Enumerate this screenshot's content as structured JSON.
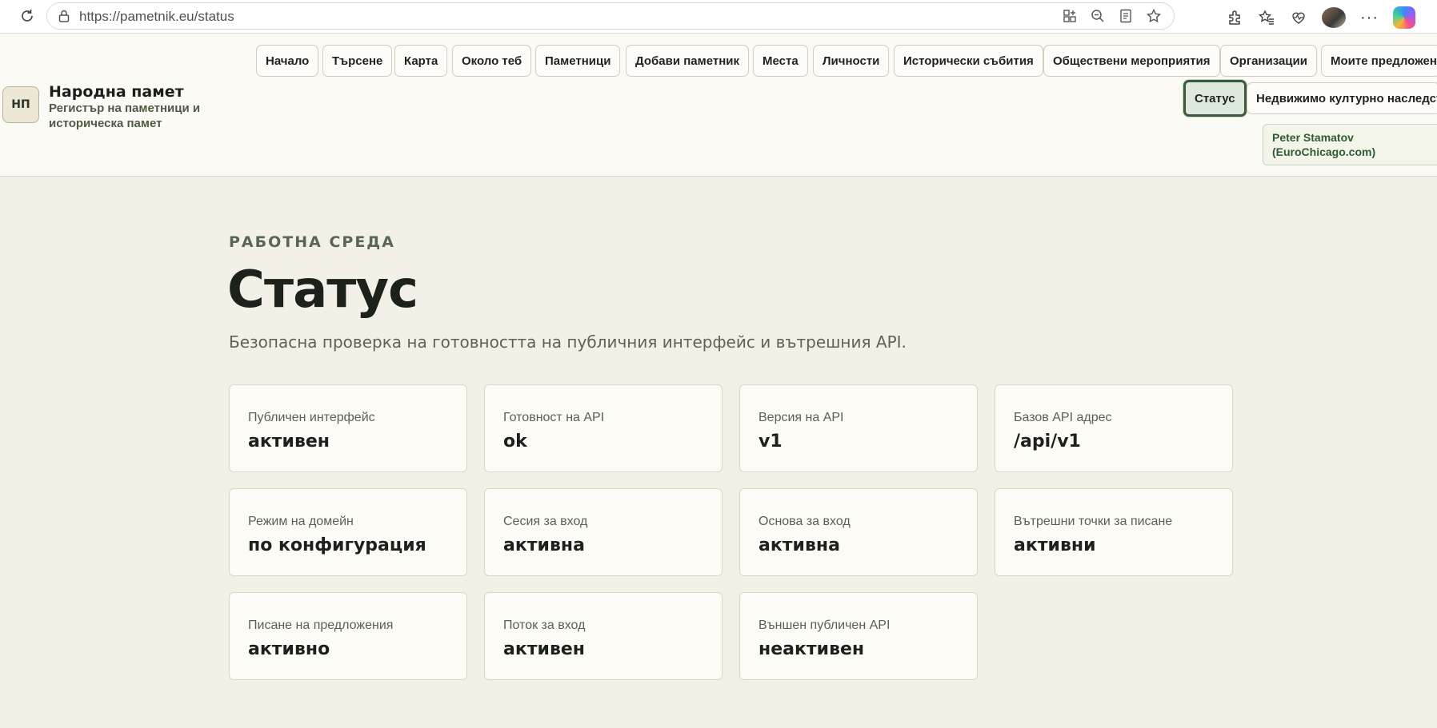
{
  "browser": {
    "url": "https://pametnik.eu/status",
    "icons": [
      "reload-icon",
      "lock-icon",
      "apps-icon",
      "zoom-out-icon",
      "reader-icon",
      "star-icon",
      "extensions-icon",
      "favorites-icon",
      "health-icon",
      "profile-avatar",
      "copilot-icon",
      "more-icon"
    ]
  },
  "brand": {
    "logo": "НП",
    "title": "Народна памет",
    "subtitle": "Регистър на паметници и историческа памет"
  },
  "nav": {
    "row1": [
      "Начало",
      "Търсене",
      "Карта",
      "Около теб",
      "Паметници",
      "Добави паметник",
      "Места",
      "Личности",
      "Исторически събития",
      "Обществени мероприятия",
      "Организации",
      "Моите предложения"
    ],
    "row2": [
      "Статус",
      "Недвижимо културно наследство"
    ],
    "active": "Статус",
    "user_line1": "Peter Stamatov",
    "user_line2": "(EuroChicago.com)"
  },
  "colors": {
    "accent": "#3d5a3f",
    "background": "#f3f0e8",
    "card": "#fdfbf6"
  },
  "main": {
    "eyebrow": "РАБОТНА СРЕДА",
    "title": "Статус",
    "description": "Безопасна проверка на готовността на публичния интерфейс и вътрешния API.",
    "cards": [
      {
        "label": "Публичен интерфейс",
        "value": "активен"
      },
      {
        "label": "Готовност на API",
        "value": "ok"
      },
      {
        "label": "Версия на API",
        "value": "v1"
      },
      {
        "label": "Базов API адрес",
        "value": "/api/v1"
      },
      {
        "label": "Режим на домейн",
        "value": "по конфигурация"
      },
      {
        "label": "Сесия за вход",
        "value": "активна"
      },
      {
        "label": "Основа за вход",
        "value": "активна"
      },
      {
        "label": "Вътрешни точки за писане",
        "value": "активни"
      },
      {
        "label": "Писане на предложения",
        "value": "активно"
      },
      {
        "label": "Поток за вход",
        "value": "активен"
      },
      {
        "label": "Външен публичен API",
        "value": "неактивен"
      }
    ]
  }
}
